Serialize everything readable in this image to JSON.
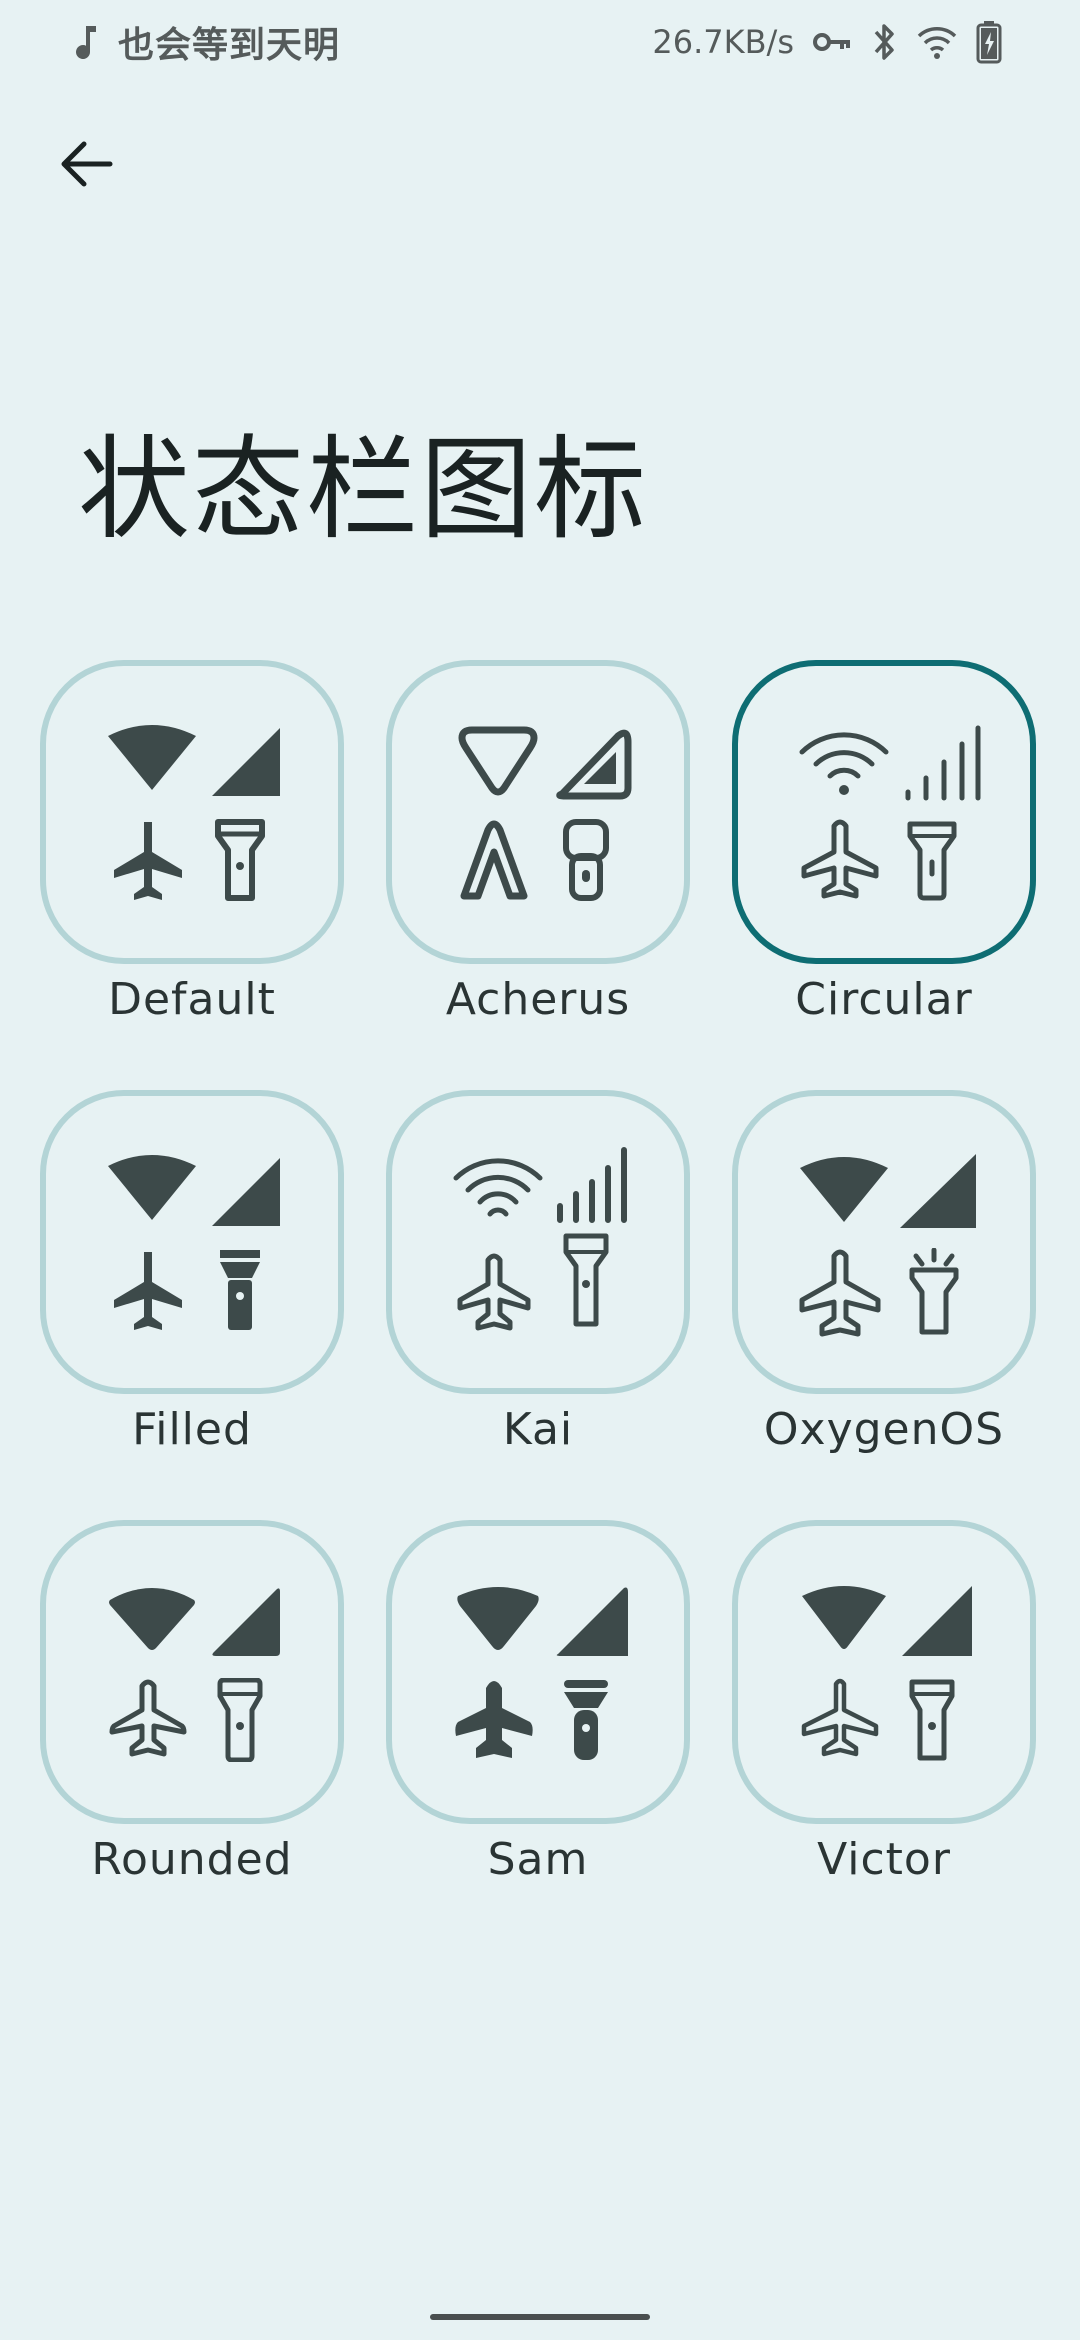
{
  "status_bar": {
    "music_icon": "music-note-icon",
    "now_playing": "也会等到天明",
    "net_speed": "26.7KB/s",
    "icons": [
      "vpn-key-icon",
      "bluetooth-icon",
      "wifi-icon",
      "battery-charging-icon"
    ]
  },
  "header": {
    "back_icon": "arrow-back-icon",
    "title": "状态栏图标"
  },
  "icon_packs": [
    {
      "label": "Default",
      "style": "default",
      "selected": false
    },
    {
      "label": "Acherus",
      "style": "acherus",
      "selected": false
    },
    {
      "label": "Circular",
      "style": "circular",
      "selected": true
    },
    {
      "label": "Filled",
      "style": "filled",
      "selected": false
    },
    {
      "label": "Kai",
      "style": "kai",
      "selected": false
    },
    {
      "label": "OxygenOS",
      "style": "oxygen",
      "selected": false
    },
    {
      "label": "Rounded",
      "style": "rounded",
      "selected": false
    },
    {
      "label": "Sam",
      "style": "sam",
      "selected": false
    },
    {
      "label": "Victor",
      "style": "victor",
      "selected": false
    }
  ],
  "colors": {
    "background": "#e7f2f3",
    "tile_border": "#b3d4d6",
    "selected_border": "#0e6d73",
    "icon": "#3d4a4a"
  }
}
